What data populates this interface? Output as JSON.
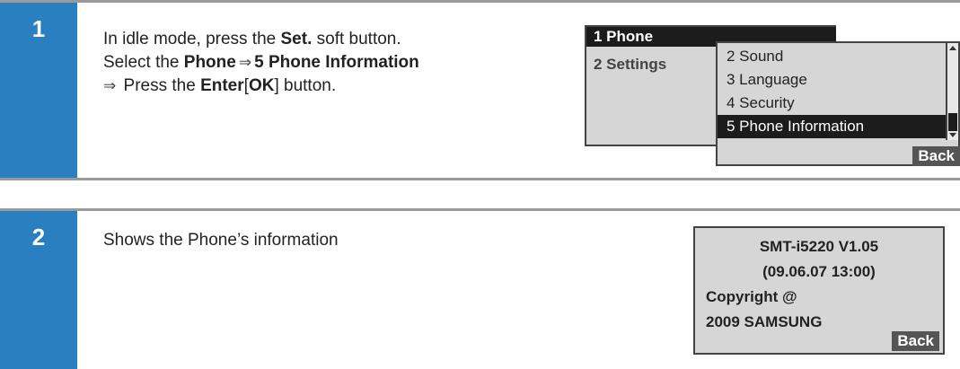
{
  "step1": {
    "number": "1",
    "line1_pre": "In idle mode, press the ",
    "line1_bold": "Set.",
    "line1_post": " soft button.",
    "line2_pre": "Select the ",
    "line2_bold1": "Phone",
    "line2_arrow": "⇒",
    "line2_bold2": "5 Phone Information",
    "line3_arrow": "⇒",
    "line3_pre": " Press the ",
    "line3_bold1": "Enter",
    "line3_bracket_open": "[",
    "line3_bold2": "OK",
    "line3_bracket_close": "]",
    "line3_post": " button.",
    "lcd": {
      "menu_item1": "1 Phone",
      "menu_item2": "2 Settings",
      "submenu": [
        "2 Sound",
        "3 Language",
        "4 Security",
        "5 Phone Information"
      ],
      "softkey": "Back"
    }
  },
  "step2": {
    "number": "2",
    "text": "Shows the Phone’s information",
    "lcd": {
      "line1": "SMT-i5220 V1.05",
      "line2": "(09.06.07  13:00)",
      "line3": "Copyright @",
      "line4": "2009 SAMSUNG",
      "softkey": "Back"
    }
  }
}
